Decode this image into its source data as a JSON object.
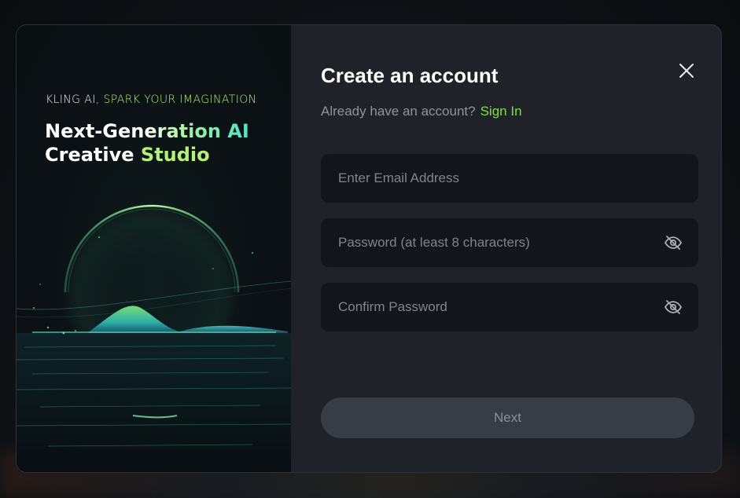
{
  "promo": {
    "tagline_prefix": "KLING AI, ",
    "tagline_highlight": "SPARK YOUR IMAGINATION",
    "headline_line1_start": "Next-Gen",
    "headline_line1_grad": "eration AI",
    "headline_line2_start": "Creative ",
    "headline_line2_accent": "Studio"
  },
  "form": {
    "title": "Create an account",
    "have_account_text": "Already have an account?",
    "sign_in_label": "Sign In",
    "email_placeholder": "Enter Email Address",
    "password_placeholder": "Password (at least 8 characters)",
    "confirm_placeholder": "Confirm Password",
    "next_label": "Next"
  },
  "icons": {
    "close": "close-icon",
    "password_toggle": "eye-off-icon"
  },
  "colors": {
    "accent": "#7ee23a",
    "panel": "#1f2329",
    "field": "#121519",
    "button_disabled": "#383d45"
  }
}
